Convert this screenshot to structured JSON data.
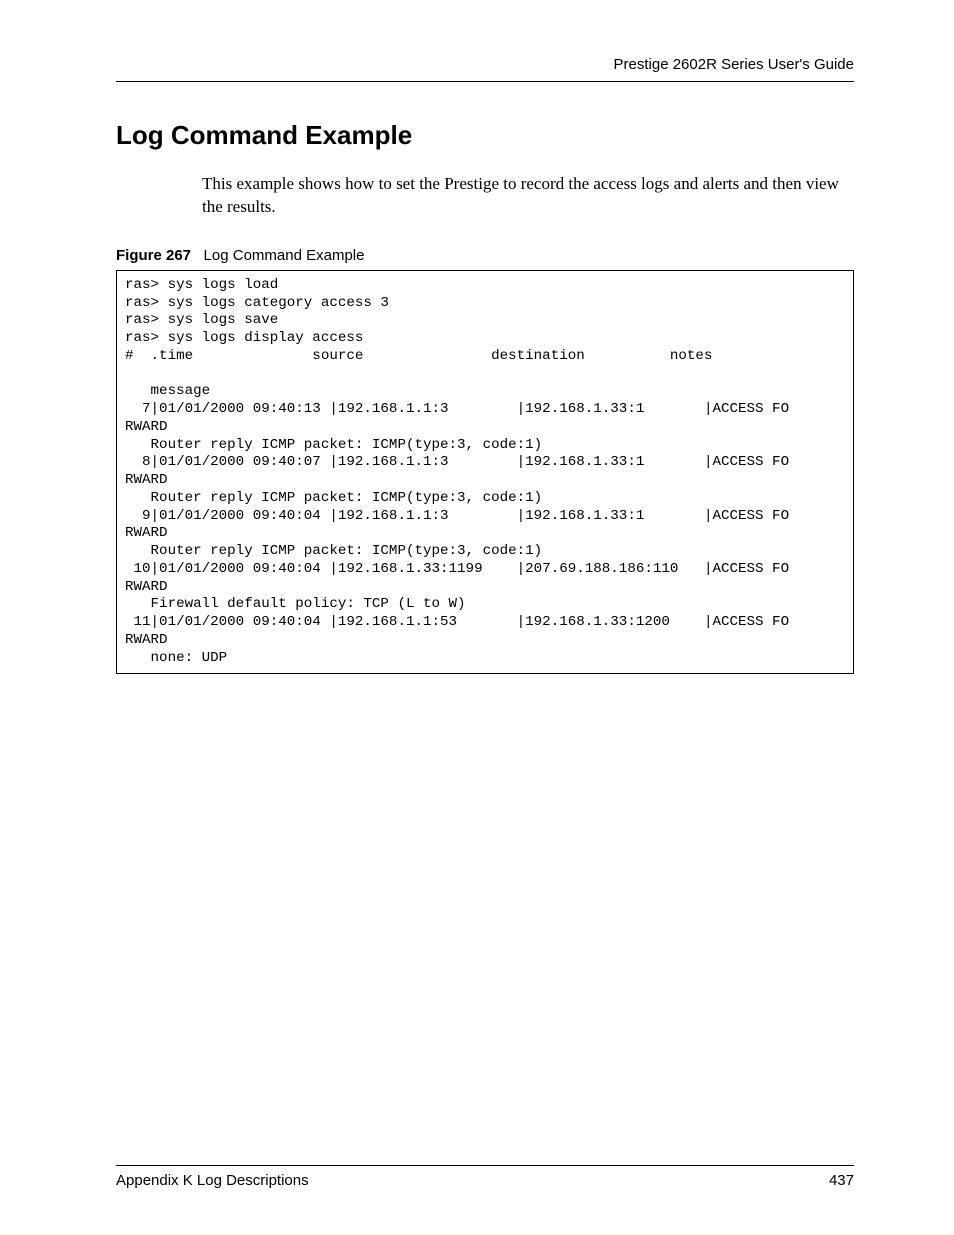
{
  "header": {
    "guide_title": "Prestige 2602R Series User's Guide"
  },
  "section": {
    "title": "Log Command Example",
    "body": "This example shows how to set the Prestige to record the access logs and alerts and then view the results."
  },
  "figure": {
    "label": "Figure 267",
    "caption": "Log Command Example"
  },
  "code": {
    "lines": "ras> sys logs load\nras> sys logs category access 3\nras> sys logs save\nras> sys logs display access\n#  .time              source               destination          notes\n\n   message\n  7|01/01/2000 09:40:13 |192.168.1.1:3        |192.168.1.33:1       |ACCESS FO\nRWARD\n   Router reply ICMP packet: ICMP(type:3, code:1)\n  8|01/01/2000 09:40:07 |192.168.1.1:3        |192.168.1.33:1       |ACCESS FO\nRWARD\n   Router reply ICMP packet: ICMP(type:3, code:1)\n  9|01/01/2000 09:40:04 |192.168.1.1:3        |192.168.1.33:1       |ACCESS FO\nRWARD\n   Router reply ICMP packet: ICMP(type:3, code:1)\n 10|01/01/2000 09:40:04 |192.168.1.33:1199    |207.69.188.186:110   |ACCESS FO\nRWARD\n   Firewall default policy: TCP (L to W)\n 11|01/01/2000 09:40:04 |192.168.1.1:53       |192.168.1.33:1200    |ACCESS FO\nRWARD\n   none: UDP"
  },
  "footer": {
    "appendix": "Appendix K Log Descriptions",
    "page_number": "437"
  }
}
